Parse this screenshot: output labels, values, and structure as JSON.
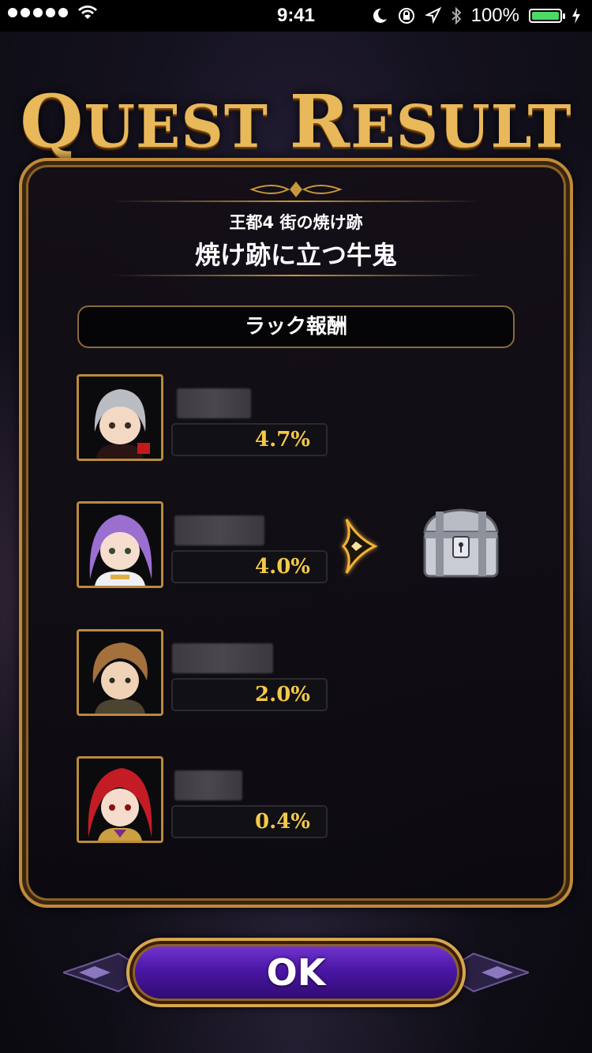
{
  "status_bar": {
    "time": "9:41",
    "battery": "100%"
  },
  "title": {
    "word1_cap": "Q",
    "word1_rest": "UEST",
    "word2_cap": "R",
    "word2_rest": "ESULT"
  },
  "quest": {
    "area": "王都4 街の焼け跡",
    "name": "焼け跡に立つ牛鬼"
  },
  "section": {
    "label": "ラック報酬"
  },
  "members": [
    {
      "rate": "4.7%",
      "portrait": "silver-hair-unit-portrait"
    },
    {
      "rate": "4.0%",
      "portrait": "purple-hair-unit-portrait"
    },
    {
      "rate": "2.0%",
      "portrait": "brown-hair-unit-portrait"
    },
    {
      "rate": "0.4%",
      "portrait": "red-hair-unit-portrait"
    }
  ],
  "reward": {
    "icon": "silver-treasure-chest-icon",
    "indicator": "arrow-icon"
  },
  "ok_button": {
    "label": "OK"
  },
  "colors": {
    "gold": "#c08a3a",
    "rate_text": "#f3c94a",
    "ok_purple": "#4b17a6",
    "battery_green": "#4cd964"
  }
}
